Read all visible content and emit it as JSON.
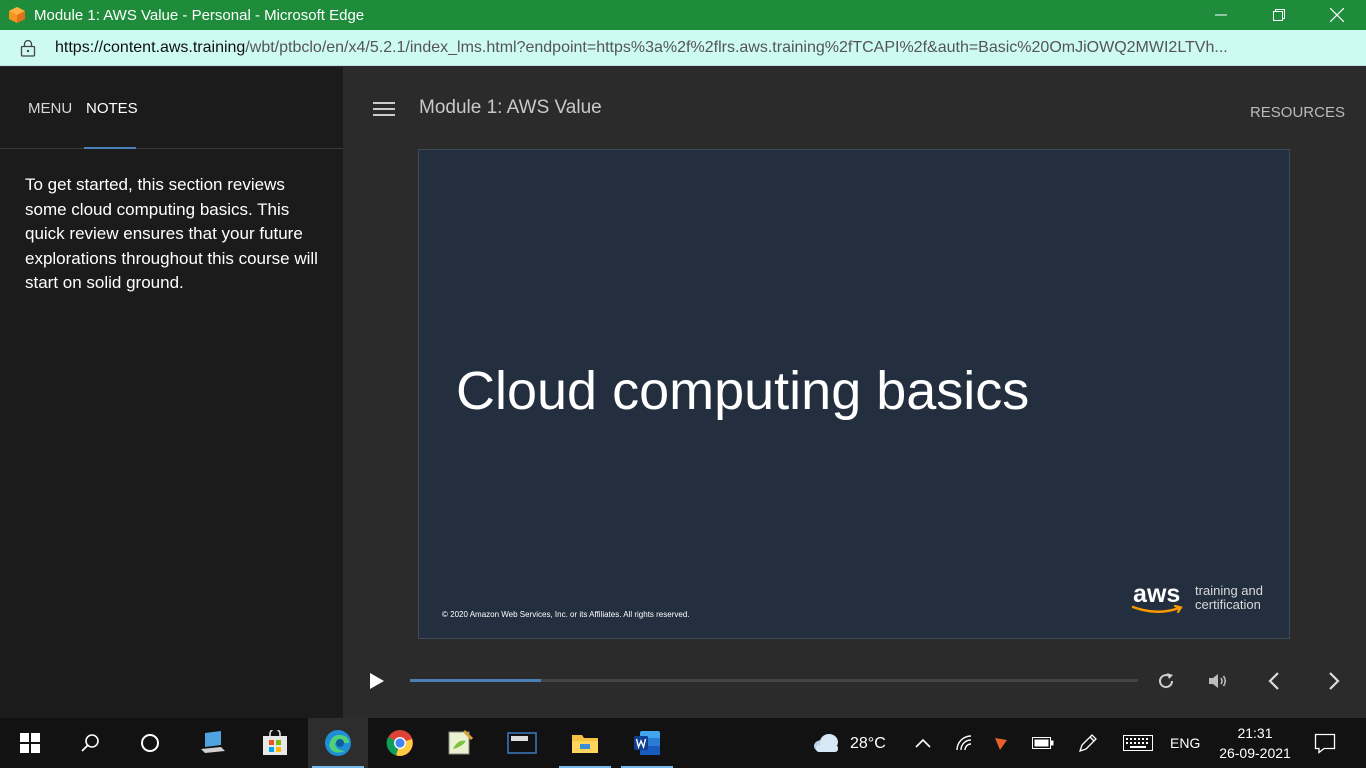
{
  "browser": {
    "window_title": "Module 1: AWS Value - Personal - Microsoft Edge",
    "url_domain": "https://content.aws.training",
    "url_rest": "/wbt/ptbclo/en/x4/5.2.1/index_lms.html?endpoint=https%3a%2f%2flrs.aws.training%2fTCAPI%2f&auth=Basic%20OmJiOWQ2MWI2LTVh..."
  },
  "sidebar": {
    "tabs": [
      {
        "label": "MENU"
      },
      {
        "label": "NOTES"
      }
    ],
    "notes_text": "To get started, this section reviews some cloud computing basics. This quick review ensures that your future explorations throughout this course will start on solid ground."
  },
  "header": {
    "module_title": "Module 1: AWS Value",
    "resources_label": "RESOURCES"
  },
  "slide": {
    "heading": "Cloud computing basics",
    "copyright": "© 2020 Amazon Web Services, Inc. or its Affiliates. All rights reserved.",
    "logo_word": "aws",
    "logo_tagline_1": "training and",
    "logo_tagline_2": "certification"
  },
  "player": {
    "progress_fraction": 0.18
  },
  "taskbar": {
    "weather_temp": "28°C",
    "language": "ENG",
    "time": "21:31",
    "date": "26-09-2021"
  },
  "colors": {
    "titlebar": "#1f8c3c",
    "addressbar": "#cdfbf4",
    "slide_bg": "#232f3e",
    "accent": "#4a7fb5",
    "aws_orange": "#ff9900"
  }
}
